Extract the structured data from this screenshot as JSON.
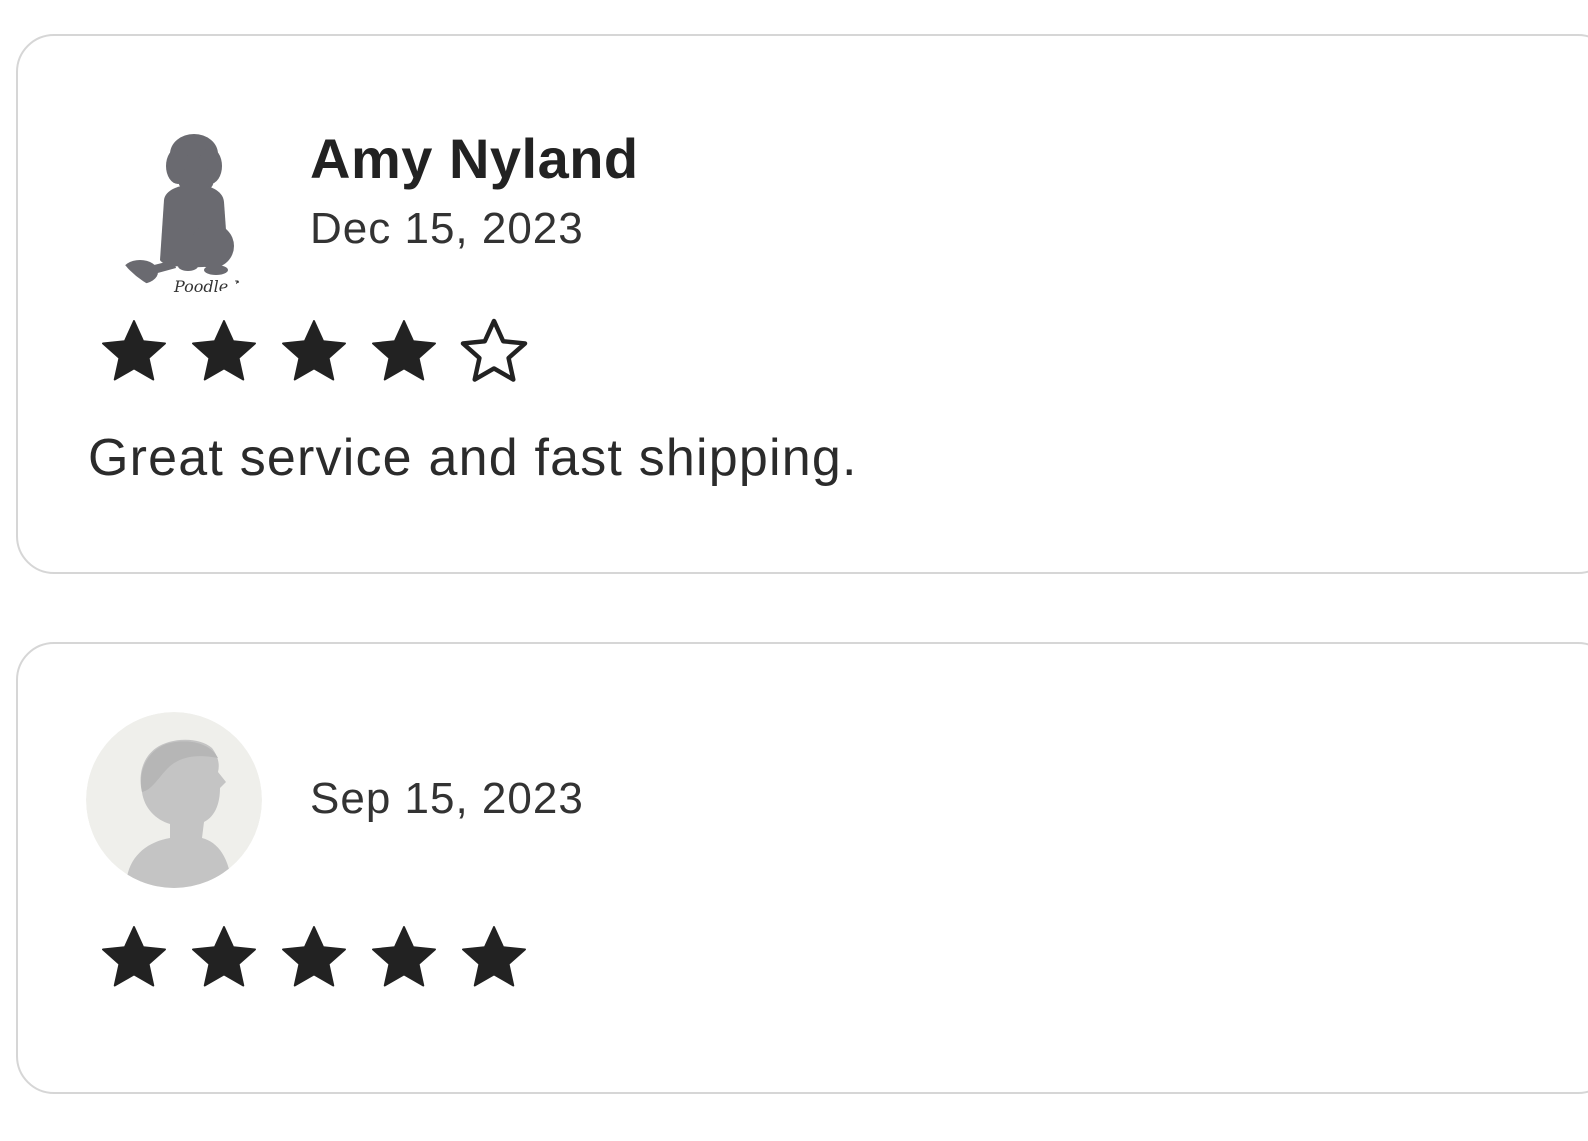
{
  "reviews": [
    {
      "reviewer_name": "Amy Nyland",
      "date": "Dec 15, 2023",
      "rating": 4,
      "max_rating": 5,
      "text": "Great service and fast shipping.",
      "avatar_icon": "poodle-avatar-icon",
      "avatar_caption": "Poodle Nr"
    },
    {
      "reviewer_name": "",
      "date": "Sep 15, 2023",
      "rating": 5,
      "max_rating": 5,
      "text": "",
      "avatar_icon": "default-person-avatar-icon"
    }
  ],
  "colors": {
    "star_fill": "#222222",
    "card_border": "#d6d6d6",
    "default_avatar_bg": "#efefeb",
    "default_avatar_silhouette": "#c4c4c4"
  }
}
